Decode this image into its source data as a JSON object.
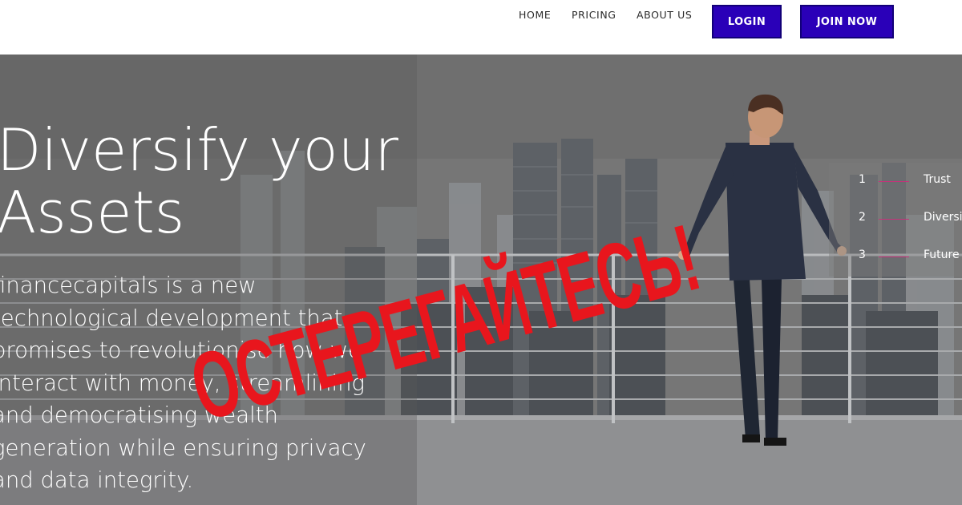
{
  "nav": {
    "home": "HOME",
    "pricing": "PRICING",
    "about": "ABOUT US",
    "login": "LOGIN",
    "join": "JOIN NOW"
  },
  "hero": {
    "title_line1": "Diversify your",
    "title_line2": "Assets",
    "body_lines": [
      "financecapitals is a new",
      "technological development that",
      "promises to revolutionise how we",
      "interact with money, streamlining",
      "and democratising wealth",
      "generation while ensuring privacy",
      "and data integrity."
    ]
  },
  "steps": [
    {
      "num": "1",
      "label": "Trust"
    },
    {
      "num": "2",
      "label": "Diversify"
    },
    {
      "num": "3",
      "label": "Future"
    }
  ],
  "overlay": {
    "warning_text": "ОСТЕРЕГАЙТЕСЬ!"
  },
  "colors": {
    "button_bg": "#2a00b8",
    "accent_line": "#c7317a",
    "warning_red": "#e8161d"
  }
}
